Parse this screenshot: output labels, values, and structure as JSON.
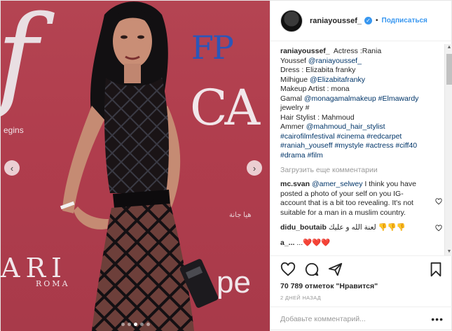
{
  "post": {
    "username": "raniayoussef_",
    "follow_label": "Подписаться",
    "caption_lines": [
      {
        "text": "Actress :Rania"
      },
      {
        "text": "Youssef "
      },
      {
        "text": "Dress : Elizabita franky"
      },
      {
        "text": "Milhigue "
      },
      {
        "text": "Makeup Artist : mona"
      },
      {
        "text": "Gamal "
      },
      {
        "text": "jewelry #"
      },
      {
        "text": "Hair Stylist : Mahmoud"
      },
      {
        "text": "Ammer "
      }
    ],
    "caption_links": {
      "mention_rania": "@raniayoussef_",
      "mention_elizabita": "@Elizabitafranky",
      "mention_mona": "@monagamalmakeup",
      "tag_elmawardy": "#Elmawardy",
      "mention_mahmoud": "@mahmoud_hair_stylist",
      "tags_line1": "#cairofilmfestival #cinema #redcarpet",
      "tags_line2": "#raniah_youseff #mystyle #actress #ciff40",
      "tags_line3": "#drama #film"
    },
    "load_more": "Загрузить еще комментарии",
    "comments": [
      {
        "username": "mc.svan",
        "mention": "@amer_selwey",
        "text": " I think you have posted a photo of your self on you IG-account that is a bit too revealing. It's not suitable for a man in a muslim country."
      },
      {
        "username": "didu_boutaib",
        "text": "لعنة الله و عليك 👎👎👎"
      },
      {
        "username": "a_...",
        "text": "...❤️❤️❤️"
      }
    ],
    "likes": "70 789 отметок \"Нравится\"",
    "timestamp": "2 ДНЕЙ НАЗАД",
    "add_comment_placeholder": "Добавьте комментарий...",
    "options": "•••"
  },
  "media": {
    "brand_fp": "FP",
    "brand_ca": "CA",
    "brand_f": "f",
    "brand_ari": "ARI",
    "brand_roma": "ROMA",
    "brand_egins": "egins",
    "brand_pe": "pe",
    "watermark": "هيا جانة",
    "slides": 5,
    "active_slide": 2
  },
  "colors": {
    "accent": "#3897f0",
    "link": "#003569",
    "muted": "#999999",
    "backdrop": "#b03d4d"
  }
}
